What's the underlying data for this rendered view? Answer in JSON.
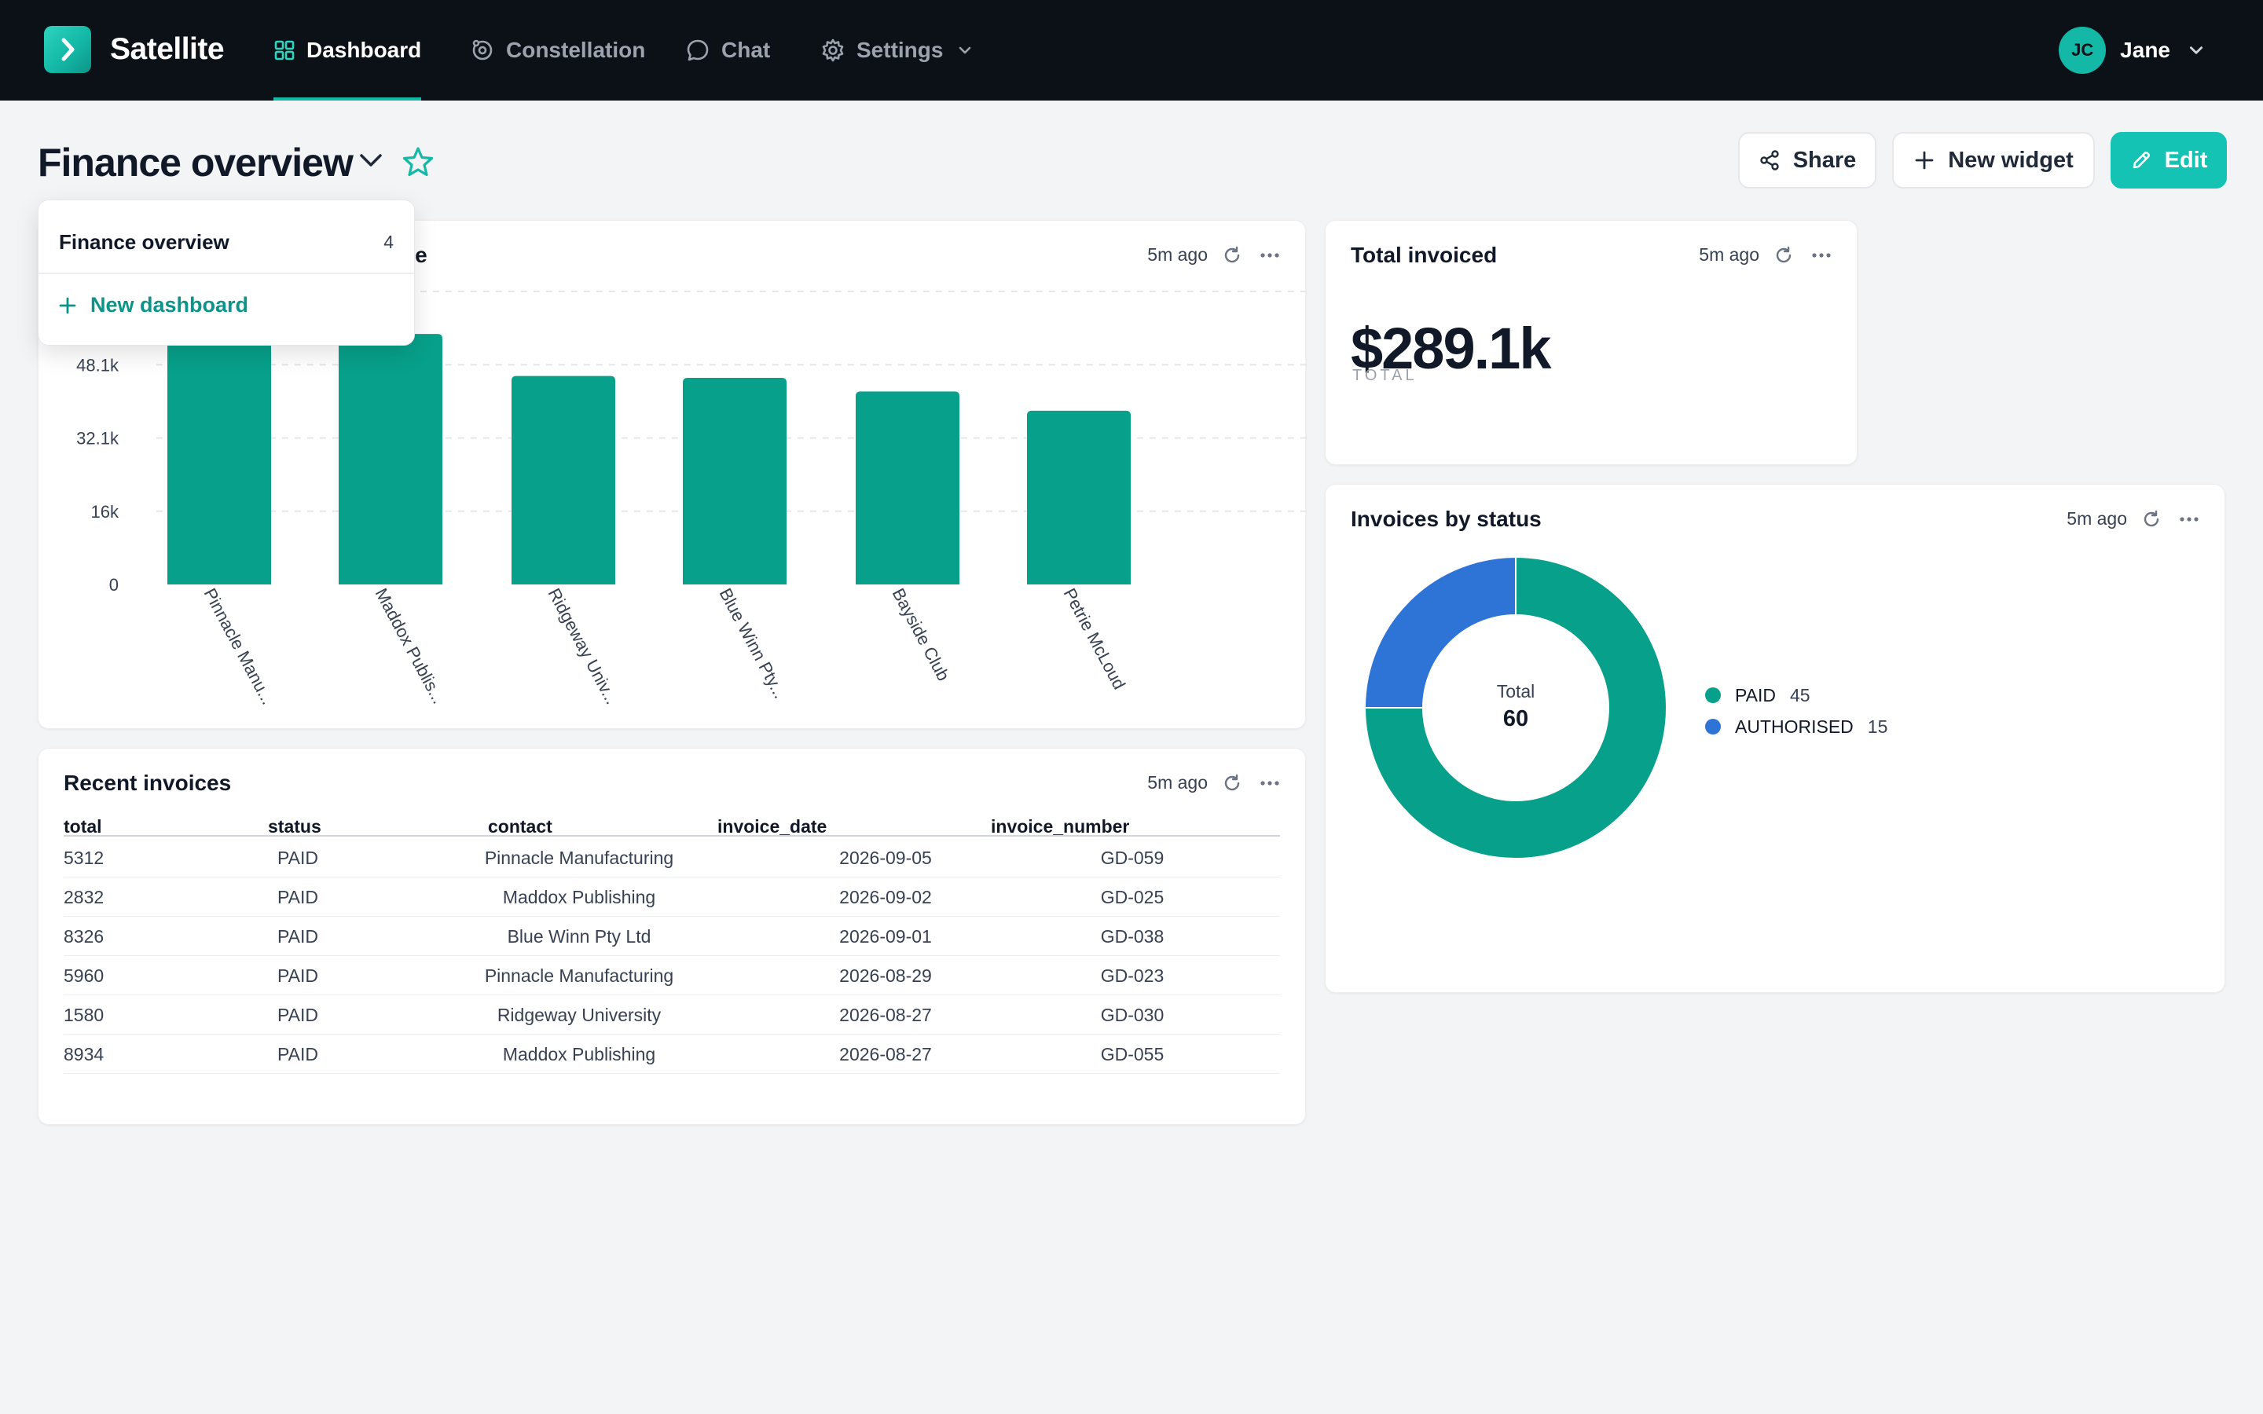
{
  "nav": {
    "brand": "Satellite",
    "items": [
      {
        "label": "Dashboard",
        "icon": "grid-icon",
        "active": true
      },
      {
        "label": "Constellation",
        "icon": "orbit-icon"
      },
      {
        "label": "Chat",
        "icon": "chat-bubble-icon"
      },
      {
        "label": "Settings",
        "icon": "gear-icon"
      }
    ],
    "user": {
      "initials": "JC",
      "name": "Jane"
    }
  },
  "header": {
    "title": "Finance overview",
    "share_label": "Share",
    "new_widget_label": "New widget",
    "edit_label": "Edit"
  },
  "dropdown": {
    "item_label": "Finance overview",
    "item_count": "4",
    "new_label": "New dashboard"
  },
  "widgets": {
    "revenue": {
      "title_visible": "ue",
      "ago": "5m ago"
    },
    "total": {
      "title": "Total invoiced",
      "ago": "5m ago",
      "value": "$289.1k",
      "sub": "TOTAL"
    },
    "status": {
      "title": "Invoices by status",
      "ago": "5m ago",
      "center_label": "Total",
      "center_value": "60"
    },
    "recent": {
      "title": "Recent invoices",
      "ago": "5m ago"
    }
  },
  "chart_data": [
    {
      "type": "bar",
      "categories": [
        "Pinnacle Manu...",
        "Maddox Publis...",
        "Ridgeway Univ...",
        "Blue Winn Pty...",
        "Bayside Club",
        "Petrie McLoud"
      ],
      "values": [
        57500,
        54800,
        45600,
        45200,
        42200,
        38000
      ],
      "yticks": [
        "0",
        "16k",
        "32.1k",
        "48.1k"
      ],
      "ylim": [
        0,
        64100
      ],
      "color": "#07a08a"
    },
    {
      "type": "pie",
      "labels": [
        "PAID",
        "AUTHORISED"
      ],
      "values": [
        45,
        15
      ],
      "colors": [
        "#07a08a",
        "#2d74d6"
      ]
    }
  ],
  "table": {
    "columns": [
      "total",
      "status",
      "contact",
      "invoice_date",
      "invoice_number"
    ],
    "rows": [
      [
        "5312",
        "PAID",
        "Pinnacle Manufacturing",
        "2026-09-05",
        "GD-059"
      ],
      [
        "2832",
        "PAID",
        "Maddox Publishing",
        "2026-09-02",
        "GD-025"
      ],
      [
        "8326",
        "PAID",
        "Blue Winn Pty Ltd",
        "2026-09-01",
        "GD-038"
      ],
      [
        "5960",
        "PAID",
        "Pinnacle Manufacturing",
        "2026-08-29",
        "GD-023"
      ],
      [
        "1580",
        "PAID",
        "Ridgeway University",
        "2026-08-27",
        "GD-030"
      ],
      [
        "8934",
        "PAID",
        "Maddox Publishing",
        "2026-08-27",
        "GD-055"
      ]
    ]
  }
}
